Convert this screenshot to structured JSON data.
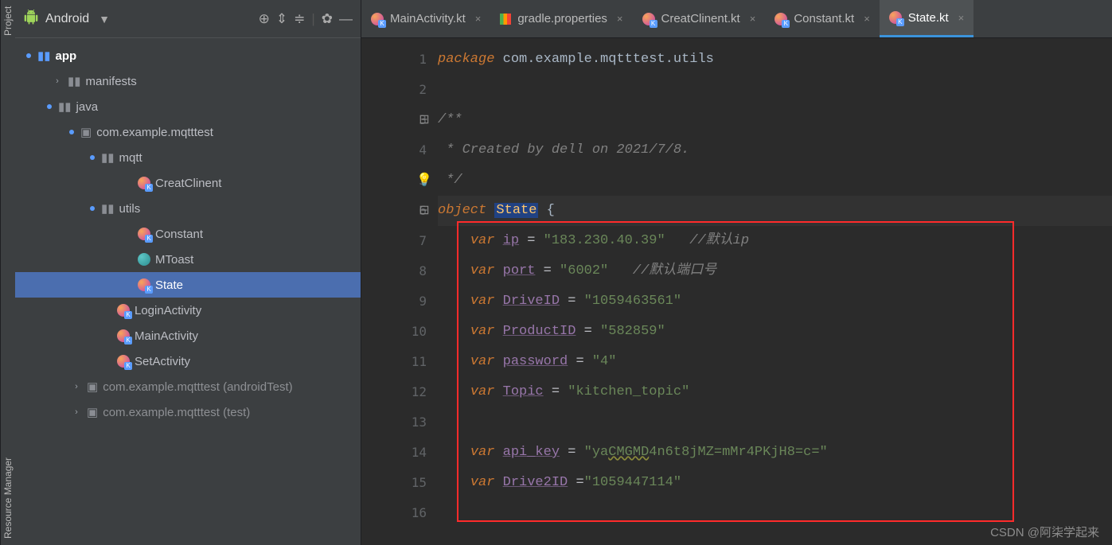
{
  "vtabs": {
    "top": "Project",
    "bottom": "Resource Manager"
  },
  "side_head": {
    "title": "Android"
  },
  "tree": {
    "app": "app",
    "manifests": "manifests",
    "java": "java",
    "pkg_main": "com.example.mqtttest",
    "pkg_android_test": "com.example.mqtttest (androidTest)",
    "pkg_test": "com.example.mqtttest (test)",
    "mqtt": "mqtt",
    "creat_clinent": "CreatClinent",
    "utils": "utils",
    "constant": "Constant",
    "mtoast": "MToast",
    "state": "State",
    "login_activity": "LoginActivity",
    "main_activity": "MainActivity",
    "set_activity": "SetActivity"
  },
  "tabs": {
    "main_activity": "MainActivity.kt",
    "gradle_props": "gradle.properties",
    "creat_clinent": "CreatClinent.kt",
    "constant": "Constant.kt",
    "state": "State.kt"
  },
  "code": {
    "package_kw": "package",
    "package_name": "com.example.mqtttest.utils",
    "comment_open": "/**",
    "comment_body": " * Created by dell on 2021/7/8.",
    "comment_close": " */",
    "object_kw": "object",
    "object_name": "State",
    "brace_open": "{",
    "var_kw": "var",
    "ip_name": "ip",
    "ip_val": "\"183.230.40.39\"",
    "ip_cmt": "//默认ip",
    "port_name": "port",
    "port_val": "\"6002\"",
    "port_cmt": "//默认端口号",
    "drive_name": "DriveID",
    "drive_val": "\"1059463561\"",
    "product_name": "ProductID",
    "product_val": "\"582859\"",
    "password_name": "password",
    "password_val": "\"4\"",
    "topic_name": "Topic",
    "topic_val": "\"kitchen_topic\"",
    "api_name": "api_key",
    "api_val_pre": "\"ya",
    "api_val_wavy": "CMGMD",
    "api_val_post": "4n6t8jMZ=mMr4PKjH8=c=\"",
    "drive2_name": "Drive2ID",
    "drive2_val": "\"1059447114\"",
    "lines": [
      "1",
      "2",
      "3",
      "4",
      "5",
      "6",
      "7",
      "8",
      "9",
      "10",
      "11",
      "12",
      "13",
      "14",
      "15",
      "16"
    ]
  },
  "watermark": "CSDN @阿柒学起来"
}
